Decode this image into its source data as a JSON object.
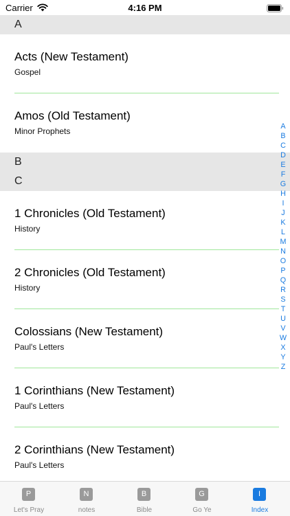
{
  "status_bar": {
    "carrier": "Carrier",
    "time": "4:16 PM"
  },
  "sections": [
    {
      "header": "A"
    },
    {
      "header": "B"
    },
    {
      "header": "C"
    }
  ],
  "rows": [
    {
      "title": "Acts (New Testament)",
      "subtitle": "Gospel"
    },
    {
      "title": "Amos (Old Testament)",
      "subtitle": "Minor Prophets"
    },
    {
      "title": "1 Chronicles (Old Testament)",
      "subtitle": "History"
    },
    {
      "title": "2 Chronicles (Old Testament)",
      "subtitle": "History"
    },
    {
      "title": "Colossians (New Testament)",
      "subtitle": "Paul's Letters"
    },
    {
      "title": "1 Corinthians (New Testament)",
      "subtitle": "Paul's Letters"
    },
    {
      "title": "2 Corinthians (New Testament)",
      "subtitle": "Paul's Letters"
    }
  ],
  "index_letters": [
    "A",
    "B",
    "C",
    "D",
    "E",
    "F",
    "G",
    "H",
    "I",
    "J",
    "K",
    "L",
    "M",
    "N",
    "O",
    "P",
    "Q",
    "R",
    "S",
    "T",
    "U",
    "V",
    "W",
    "X",
    "Y",
    "Z"
  ],
  "tabs": [
    {
      "icon_letter": "P",
      "label": "Let's Pray"
    },
    {
      "icon_letter": "N",
      "label": "notes"
    },
    {
      "icon_letter": "B",
      "label": "Bible"
    },
    {
      "icon_letter": "G",
      "label": "Go Ye"
    },
    {
      "icon_letter": "I",
      "label": "Index"
    }
  ],
  "colors": {
    "accent": "#1a7be0",
    "section_header_bg": "#e6e6e6",
    "separator": "#9fe79a"
  }
}
